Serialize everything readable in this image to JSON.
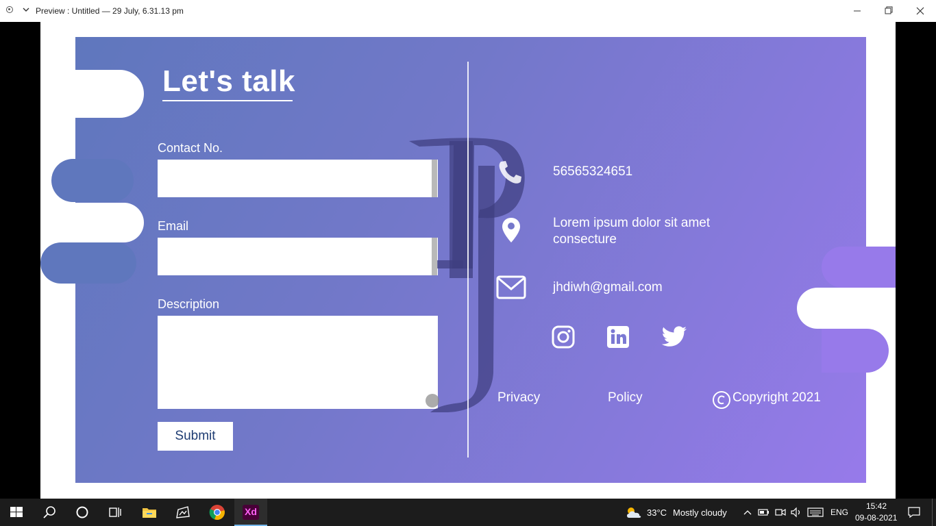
{
  "window": {
    "title": "Preview : Untitled — 29 July, 6.31.13 pm"
  },
  "form": {
    "heading": "Let's talk",
    "contact_label": "Contact No.",
    "contact_value": "",
    "email_label": "Email",
    "email_value": "",
    "description_label": "Description",
    "description_value": "",
    "submit_label": "Submit"
  },
  "info": {
    "phone": "56565324651",
    "address_line1": "Lorem ipsum dolor sit amet",
    "address_line2": "consecture",
    "email": "jhdiwh@gmail.com"
  },
  "social": [
    "instagram-icon",
    "linkedin-icon",
    "twitter-icon"
  ],
  "footer": {
    "privacy": "Privacy",
    "policy": "Policy",
    "copyright": "Copyright 2021"
  },
  "taskbar": {
    "apps": [
      "start-icon",
      "search-icon",
      "cortana-icon",
      "task-view-icon",
      "file-explorer-icon",
      "photos-icon",
      "chrome-icon",
      "adobe-xd-icon"
    ],
    "xd_label": "Xd",
    "weather_temp": "33°C",
    "weather_desc": "Mostly cloudy",
    "language": "ENG",
    "time": "15:42",
    "date": "09-08-2021"
  },
  "colors": {
    "gradient_start": "#5f77bd",
    "gradient_end": "#977aea",
    "submit_text": "#1e3c72",
    "taskbar": "#1c1c1c"
  }
}
